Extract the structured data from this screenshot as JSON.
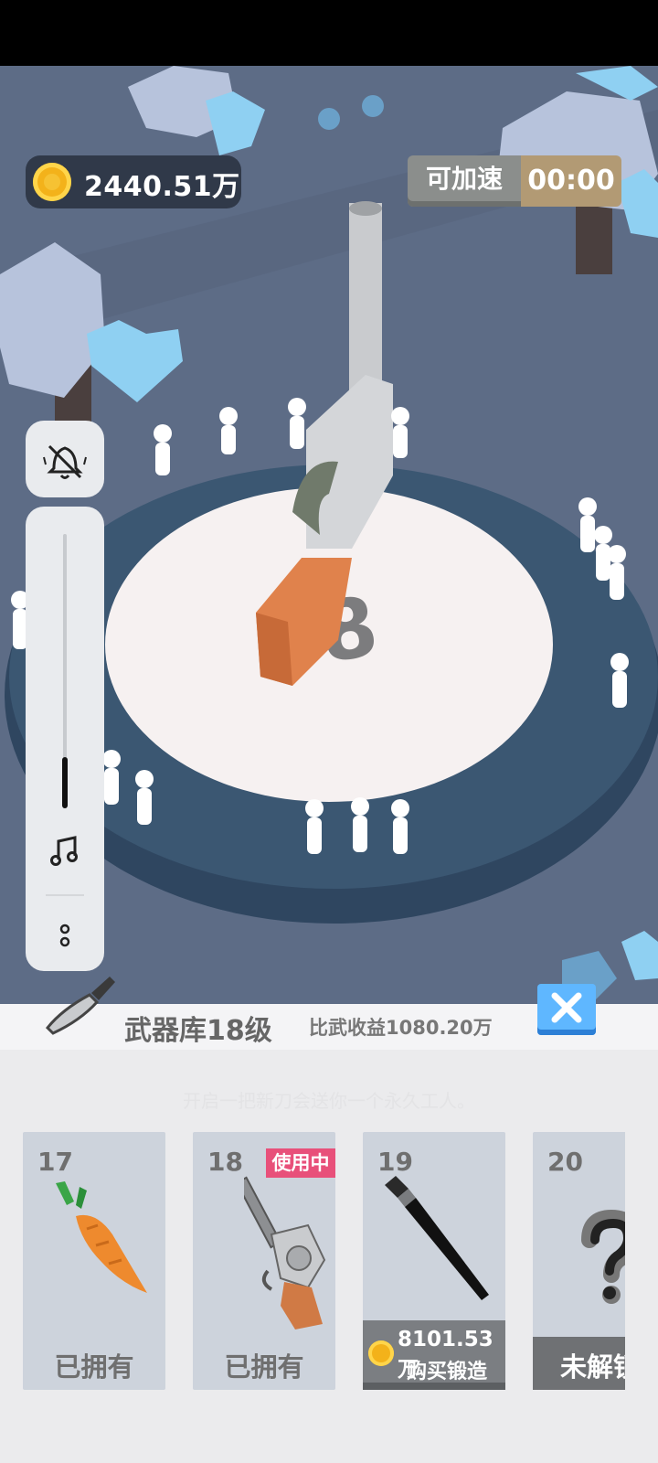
{
  "hud": {
    "coins": "2440.51万",
    "speed_label": "可加速",
    "speed_timer": "00:00"
  },
  "scene": {
    "pedestal_number": "8"
  },
  "armory": {
    "title": "武器库18级",
    "income": "比武收益1080.20万",
    "hint": "开启一把新刀会送你一个永久工人。",
    "cards": [
      {
        "level": "17",
        "item": "carrot",
        "status": "已拥有"
      },
      {
        "level": "18",
        "item": "revolver",
        "status": "已拥有",
        "badge": "使用中"
      },
      {
        "level": "19",
        "item": "brush",
        "price": "8101.53万",
        "action": "购买锻造"
      },
      {
        "level": "20",
        "item": "unknown",
        "status": "未解锁"
      }
    ]
  },
  "colors": {
    "ground": "#5c6b85",
    "pedestal": "#f6f1f1",
    "ring": "#3b5772",
    "accent_close": "#5fb7ff",
    "badge": "#e8507a"
  }
}
